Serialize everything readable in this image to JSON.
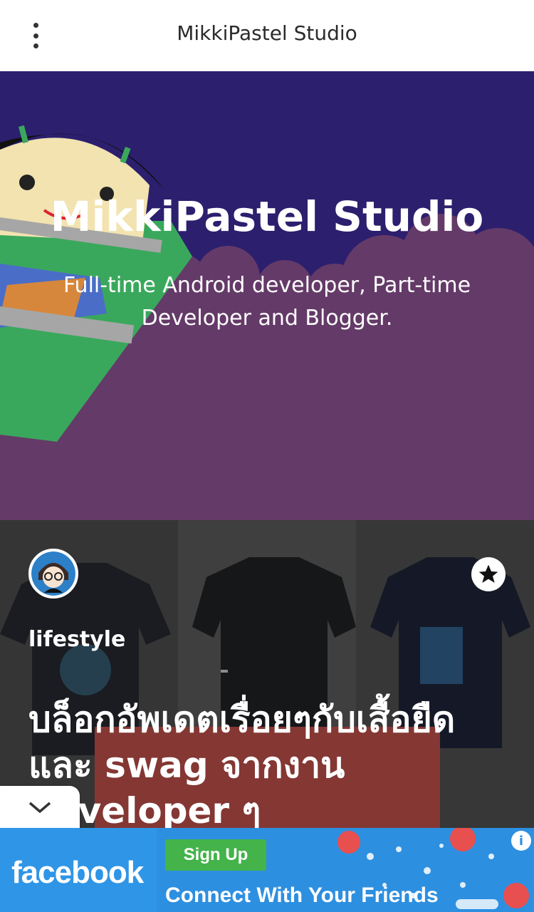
{
  "app": {
    "title": "MikkiPastel Studio"
  },
  "topbar": {
    "menu_icon": "more-vert-icon"
  },
  "hero": {
    "title": "MikkiPastel Studio",
    "subtitle": "Full-time Android developer, Part-time Developer and Blogger."
  },
  "post": {
    "category": "lifestyle",
    "title": "บล็อกอัพเดตเรื่อยๆกับเสื้อยืด และ swag จากงาน developer ๆ",
    "bookmark_icon": "star-icon",
    "avatar_icon": "author-avatar"
  },
  "collapse": {
    "icon": "chevron-down-icon"
  },
  "ad": {
    "brand": "facebook",
    "cta": "Sign Up",
    "tagline": "Connect With Your Friends",
    "info_icon": "i"
  },
  "colors": {
    "hero_top": "#2c1f6e",
    "hero_bottom": "#643a68",
    "ad_blue": "#2d8fe0",
    "signup_green": "#43b34a"
  }
}
